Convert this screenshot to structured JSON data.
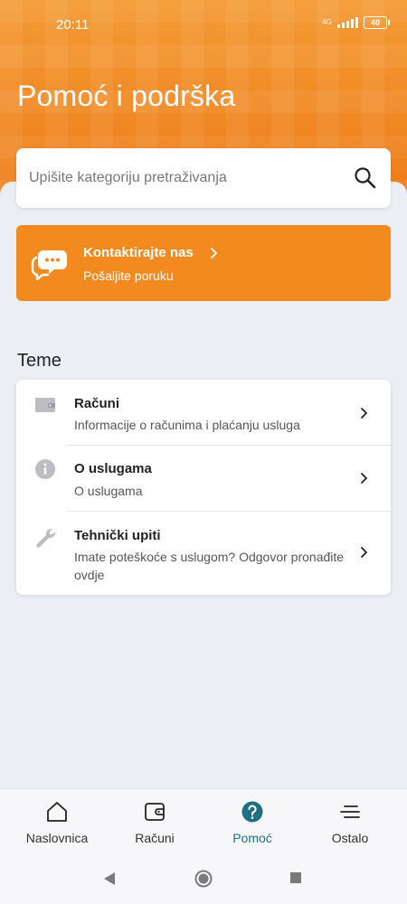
{
  "status": {
    "time": "20:11",
    "network": "4G",
    "battery": "40"
  },
  "header": {
    "title": "Pomoć i podrška"
  },
  "search": {
    "placeholder": "Upišite kategoriju pretraživanja",
    "icon": "search-icon"
  },
  "contact": {
    "title": "Kontaktirajte nas",
    "subtitle": "Pošaljite poruku",
    "icon": "chat-bubbles-icon"
  },
  "topics": {
    "heading": "Teme",
    "items": [
      {
        "title": "Računi",
        "description": "Informacije o računima i plaćanju usluga",
        "icon": "wallet-icon"
      },
      {
        "title": "O uslugama",
        "description": "O uslugama",
        "icon": "info-icon"
      },
      {
        "title": "Tehnički upiti",
        "description": "Imate poteškoće s uslugom? Odgovor pronađite ovdje",
        "icon": "wrench-icon"
      }
    ]
  },
  "nav": {
    "items": [
      {
        "label": "Naslovnica",
        "icon": "home-icon"
      },
      {
        "label": "Računi",
        "icon": "wallet-icon"
      },
      {
        "label": "Pomoć",
        "icon": "help-icon",
        "active": true
      },
      {
        "label": "Ostalo",
        "icon": "menu-icon"
      }
    ]
  },
  "colors": {
    "brand": "#f28a1f",
    "active": "#1f6f83"
  }
}
